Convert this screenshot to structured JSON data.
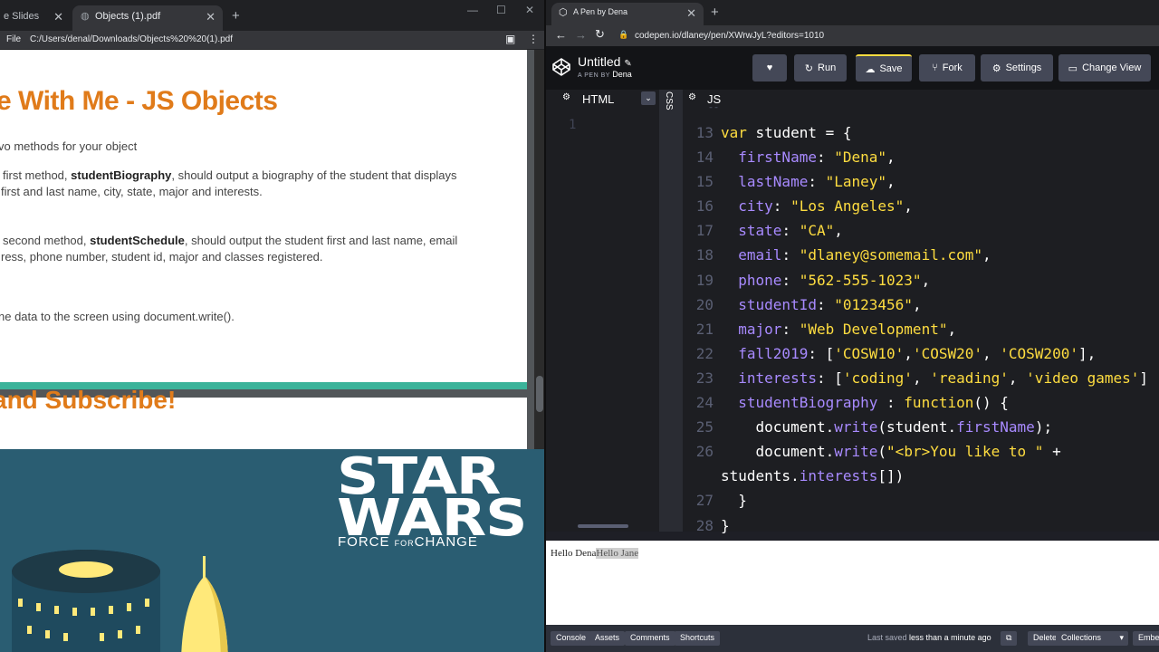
{
  "left_browser": {
    "tabs": [
      {
        "label": "e Slides"
      },
      {
        "label": "Objects (1).pdf"
      }
    ],
    "file_label": "File",
    "path": "C:/Users/denal/Downloads/Objects%20%20(1).pdf",
    "pdf": {
      "title": "e With Me - JS Objects",
      "intro": "vo methods for your object",
      "m1_pre": "first method, ",
      "m1_name": "studentBiography",
      "m1_post": ", should output a biography of the student that displays",
      "m1_line2": "first and last name, city, state, major and interests.",
      "m2_pre": "second method, ",
      "m2_name": "studentSchedule",
      "m2_post": ",  should output the student first and last name, email",
      "m2_line2": "ress, phone number, student id, major and classes registered.",
      "outro": "ne data to the screen using document.write().",
      "page2_heading": "and Subscribe!"
    }
  },
  "banner": {
    "logo_line1": "STAR",
    "logo_line2": "WARS",
    "tm": "™",
    "sub_force": "FORCE",
    "sub_for": "FOR",
    "sub_change": "CHANGE"
  },
  "right_browser": {
    "tab_label": "A Pen by Dena",
    "url": "codepen.io/dlaney/pen/XWrwJyL?editors=1010",
    "pen_title": "Untitled",
    "pen_by_prefix": "A PEN BY",
    "pen_author": "Dena",
    "buttons": {
      "run": "Run",
      "save": "Save",
      "fork": "Fork",
      "settings": "Settings",
      "change_view": "Change View"
    },
    "panes": {
      "html": "HTML",
      "css": "CSS",
      "js": "JS"
    },
    "html_line_number": "1",
    "code_lines": [
      {
        "n": "13",
        "text": "var student = {"
      },
      {
        "n": "14",
        "text": "  firstName: \"Dena\","
      },
      {
        "n": "15",
        "text": "  lastName: \"Laney\","
      },
      {
        "n": "16",
        "text": "  city: \"Los Angeles\","
      },
      {
        "n": "17",
        "text": "  state: \"CA\","
      },
      {
        "n": "18",
        "text": "  email: \"dlaney@somemail.com\","
      },
      {
        "n": "19",
        "text": "  phone: \"562-555-1023\","
      },
      {
        "n": "20",
        "text": "  studentId: \"0123456\","
      },
      {
        "n": "21",
        "text": "  major: \"Web Development\","
      },
      {
        "n": "22",
        "text": "  fall2019: ['COSW10','COSW20', 'COSW200'],"
      },
      {
        "n": "23",
        "text": "  interests: ['coding', 'reading', 'video games']"
      },
      {
        "n": "24",
        "text": "  studentBiography : function() {"
      },
      {
        "n": "25",
        "text": "    document.write(student.firstName);"
      },
      {
        "n": "26",
        "text": "    document.write(\"<br>You like to \" +"
      },
      {
        "n": "",
        "text": "students.interests[])"
      },
      {
        "n": "27",
        "text": "  }"
      },
      {
        "n": "28",
        "text": "}"
      }
    ],
    "preview": {
      "text_plain": "Hello Dena",
      "text_selected": "Hello Jane"
    },
    "footer": {
      "console": "Console",
      "assets": "Assets",
      "comments": "Comments",
      "shortcuts": "Shortcuts",
      "last_saved_prefix": "Last saved",
      "last_saved_value": "less than a minute ago",
      "delete": "Delete",
      "collections": "Collections",
      "embed": "Embe"
    }
  }
}
